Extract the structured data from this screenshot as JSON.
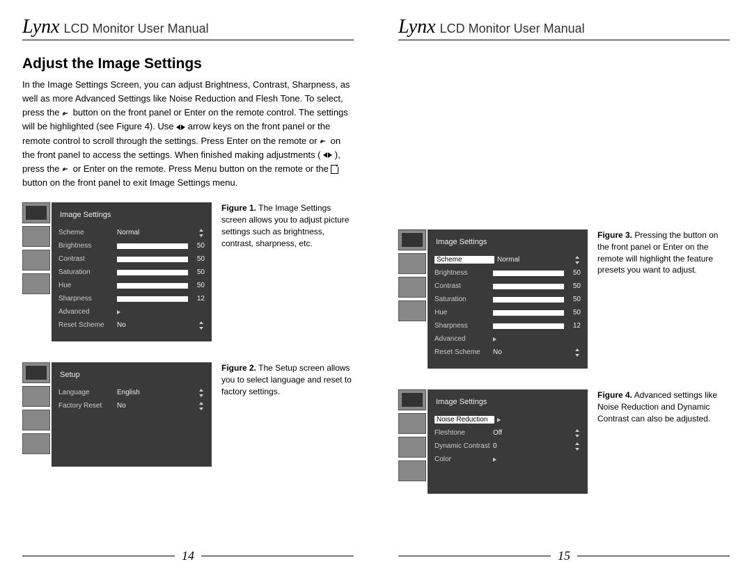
{
  "brand": "Lynx",
  "header_title": "LCD Monitor User Manual",
  "section_title": "Adjust the Image Settings",
  "body_parts": {
    "p1": "In the Image Settings Screen, you can adjust Brightness, Contrast, Sharpness, as well as more Advanced Settings like Noise Reduction and Flesh Tone. To select, press the ",
    "p2": " button on the front panel or Enter on the remote control. The settings will be highlighted (see Figure 4).  Use ",
    "p3": " arrow keys on the front panel or the remote control to scroll through the settings. Press Enter on the remote or ",
    "p4": " on the front panel to access the settings. When finished making adjustments ( ",
    "p5": " ), press the ",
    "p6": " or Enter on the remote. Press Menu button on the remote or the ",
    "p7": " button on the front panel to exit Image Settings menu."
  },
  "figures": {
    "f1": {
      "menu_title": "Image Settings",
      "rows": [
        {
          "label": "Scheme",
          "type": "select",
          "value": "Normal"
        },
        {
          "label": "Brightness",
          "type": "slider",
          "value": 50
        },
        {
          "label": "Contrast",
          "type": "slider",
          "value": 50
        },
        {
          "label": "Saturation",
          "type": "slider",
          "value": 50
        },
        {
          "label": "Hue",
          "type": "slider",
          "value": 50
        },
        {
          "label": "Sharpness",
          "type": "slider",
          "value": 12
        },
        {
          "label": "Advanced",
          "type": "arrow"
        },
        {
          "label": "Reset Scheme",
          "type": "select",
          "value": "No"
        }
      ],
      "caption_bold": "Figure 1.",
      "caption": " The Image Settings screen allows you to adjust picture settings such as brightness, contrast, sharpness, etc."
    },
    "f2": {
      "menu_title": "Setup",
      "rows": [
        {
          "label": "Language",
          "type": "select",
          "value": "English"
        },
        {
          "label": "Factory Reset",
          "type": "select",
          "value": "No"
        }
      ],
      "caption_bold": "Figure 2.",
      "caption": " The Setup screen allows you to select language and reset to factory settings."
    },
    "f3": {
      "menu_title": "Image Settings",
      "highlight": 0,
      "rows": [
        {
          "label": "Scheme",
          "type": "select",
          "value": "Normal"
        },
        {
          "label": "Brightness",
          "type": "slider",
          "value": 50
        },
        {
          "label": "Contrast",
          "type": "slider",
          "value": 50
        },
        {
          "label": "Saturation",
          "type": "slider",
          "value": 50
        },
        {
          "label": "Hue",
          "type": "slider",
          "value": 50
        },
        {
          "label": "Sharpness",
          "type": "slider",
          "value": 12
        },
        {
          "label": "Advanced",
          "type": "arrow"
        },
        {
          "label": "Reset Scheme",
          "type": "select",
          "value": "No"
        }
      ],
      "caption_bold": "Figure 3.",
      "caption": " Pressing the  button on the front panel or Enter on the remote will highlight the feature presets you want to adjust."
    },
    "f4": {
      "menu_title": "Image Settings",
      "highlight": 0,
      "rows": [
        {
          "label": "Noise Reduction",
          "type": "arrow"
        },
        {
          "label": "Fleshtone",
          "type": "select",
          "value": "Off"
        },
        {
          "label": "Dynamic Contrast",
          "type": "select",
          "value": "0"
        },
        {
          "label": "Color",
          "type": "arrow"
        }
      ],
      "caption_bold": "Figure 4.",
      "caption": " Advanced settings like Noise Reduction and Dynamic Contrast can also be adjusted."
    }
  },
  "page_left": "14",
  "page_right": "15"
}
